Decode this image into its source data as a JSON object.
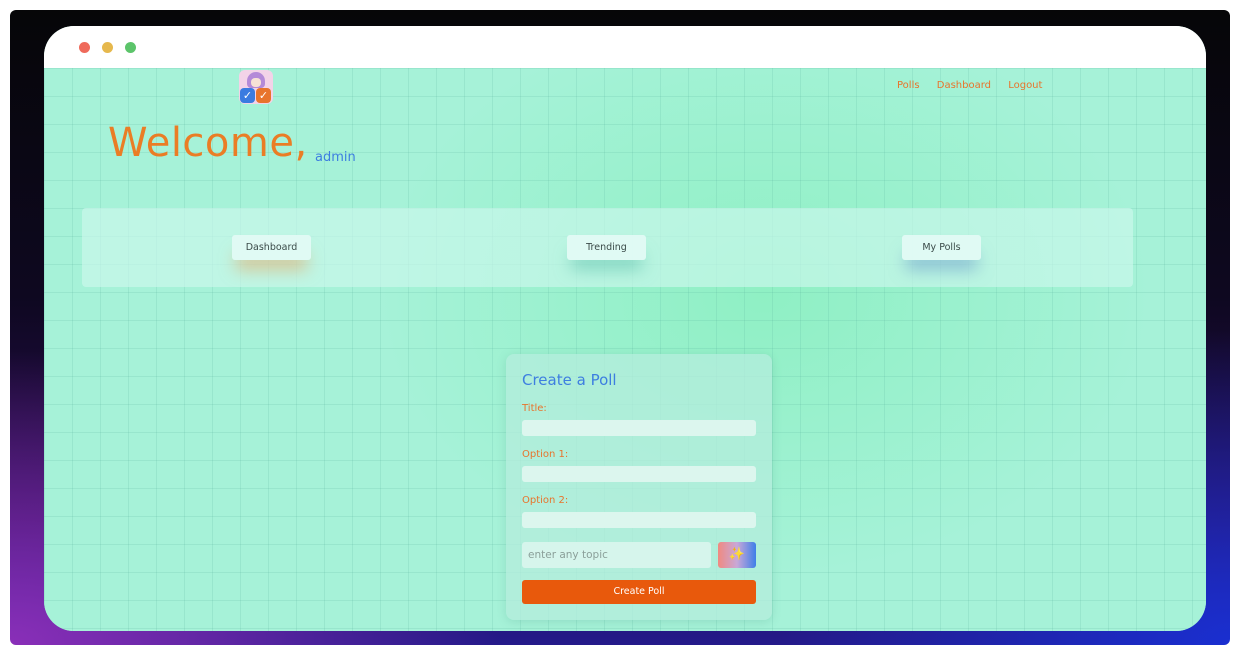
{
  "window": {
    "controls": [
      "close",
      "minimize",
      "maximize"
    ]
  },
  "logo": {
    "icon": "anime-checkmark-logo-icon"
  },
  "topnav": {
    "items": [
      {
        "label": "Polls"
      },
      {
        "label": "Dashboard"
      },
      {
        "label": "Logout"
      }
    ]
  },
  "welcome": {
    "greeting": "Welcome,",
    "username": "admin"
  },
  "tabs": [
    {
      "label": "Dashboard"
    },
    {
      "label": "Trending"
    },
    {
      "label": "My Polls"
    }
  ],
  "poll_form": {
    "title": "Create a Poll",
    "fields": [
      {
        "label": "Title:",
        "value": ""
      },
      {
        "label": "Option 1:",
        "value": ""
      },
      {
        "label": "Option 2:",
        "value": ""
      }
    ],
    "topic_placeholder": "enter any topic",
    "magic_icon": "magic-wand-icon",
    "submit_label": "Create Poll"
  },
  "colors": {
    "accent_orange": "#e8590c",
    "heading_orange": "#ea7d25",
    "link_blue": "#3d7ee0",
    "mint_background": "#a6f2d8"
  }
}
